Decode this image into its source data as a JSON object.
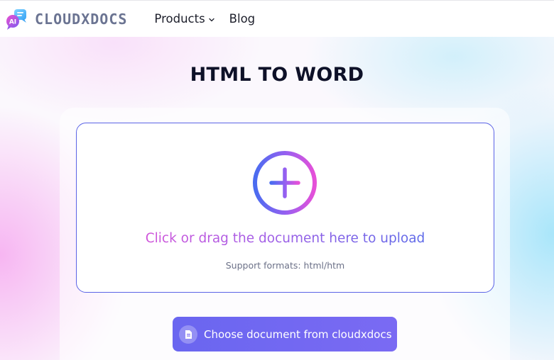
{
  "header": {
    "brand": "CLOUDXDOCS",
    "logo_badge": "AI",
    "nav": {
      "products_label": "Products",
      "blog_label": "Blog"
    }
  },
  "main": {
    "title": "HTML TO WORD",
    "upload": {
      "prompt": "Click or drag the document here to upload",
      "formats": "Support formats: html/htm"
    },
    "choose_button_label": "Choose document from cloudxdocs"
  },
  "icons": {
    "logo": "chat-bubbles-ai-icon",
    "products_dropdown": "chevron-down-icon",
    "upload": "plus-circle-icon",
    "choose": "document-icon"
  },
  "colors": {
    "accent": "#6a66f0",
    "dropzone_border": "#5b63e6",
    "gradient_start": "#ea4fd3",
    "gradient_end": "#3f6fea",
    "brand_text": "#6b7492"
  }
}
